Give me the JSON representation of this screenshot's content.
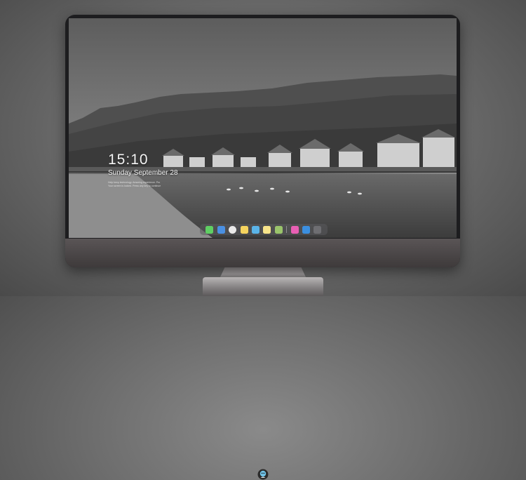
{
  "lock_screen": {
    "time": "15:10",
    "date": "Sunday September 28",
    "message_line1": "Help keep technology. Amazing experience. Pro",
    "message_line2": "Your screen is locked. Press any key to continue"
  },
  "dock": {
    "items": [
      {
        "icon": "messages-icon",
        "color": "#5fcf63"
      },
      {
        "icon": "finder-icon",
        "color": "#4a90e2"
      },
      {
        "icon": "safari-icon",
        "color": "#e9e9e9"
      },
      {
        "icon": "notes-icon",
        "color": "#f4d35e"
      },
      {
        "icon": "clapper-icon",
        "color": "#5ab4e8"
      },
      {
        "icon": "stickies-icon",
        "color": "#f7e48a"
      },
      {
        "icon": "photos-icon",
        "color": "#9ac46b"
      },
      {
        "icon": "music-icon",
        "color": "#e85fb4"
      },
      {
        "icon": "appstore-icon",
        "color": "#3b8fe0"
      },
      {
        "icon": "camera-icon",
        "color": "#6e6e72"
      }
    ]
  },
  "colors": {
    "bezel": "#1d1d1f",
    "chin": "#4b4748",
    "background": "#6e6e6e"
  }
}
